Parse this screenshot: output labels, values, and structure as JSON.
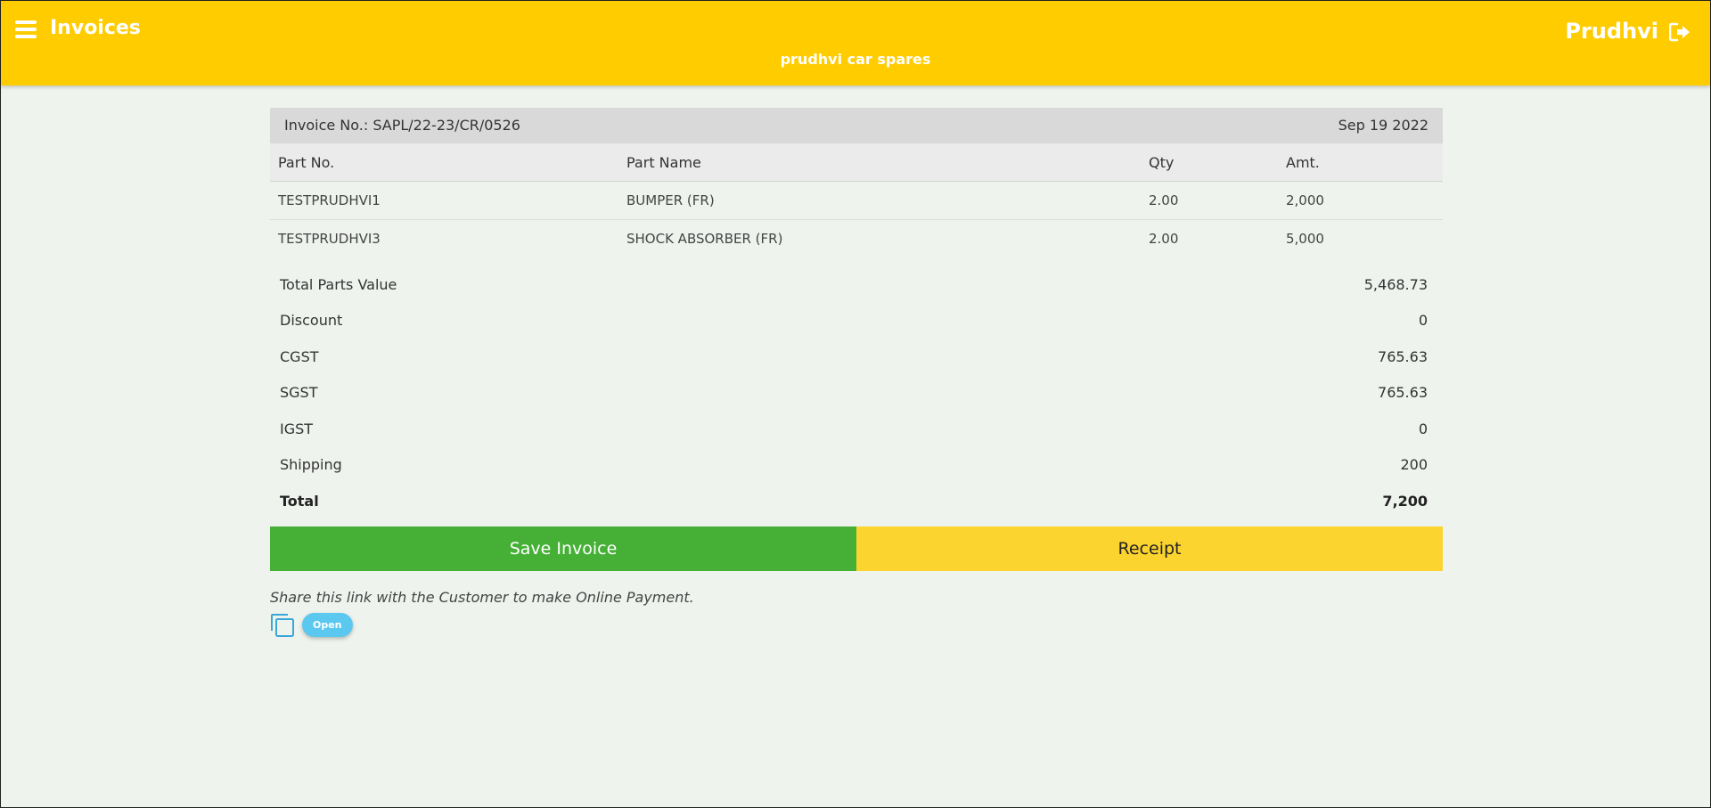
{
  "header": {
    "title": "Invoices",
    "subtitle": "prudhvi car spares",
    "user_name": "Prudhvi",
    "menu_icon": "hamburger-menu-icon",
    "logout_icon": "logout-icon",
    "background_color": "#ffcc00"
  },
  "invoice": {
    "number_label": "Invoice No.: SAPL/22-23/CR/0526",
    "date": "Sep 19 2022"
  },
  "parts_table": {
    "columns": [
      "Part No.",
      "Part Name",
      "Qty",
      "Amt."
    ],
    "rows": [
      {
        "part_no": "TESTPRUDHVI1",
        "part_name": "BUMPER (FR)",
        "qty": "2.00",
        "amt": "2,000"
      },
      {
        "part_no": "TESTPRUDHVI3",
        "part_name": "SHOCK ABSORBER (FR)",
        "qty": "2.00",
        "amt": "5,000"
      }
    ]
  },
  "summary": {
    "rows": [
      {
        "label": "Total Parts Value",
        "value": "5,468.73"
      },
      {
        "label": "Discount",
        "value": "0"
      },
      {
        "label": "CGST",
        "value": "765.63"
      },
      {
        "label": "SGST",
        "value": "765.63"
      },
      {
        "label": "IGST",
        "value": "0"
      },
      {
        "label": "Shipping",
        "value": "200"
      },
      {
        "label": "Total",
        "value": "7,200"
      }
    ]
  },
  "actions": {
    "save_label": "Save Invoice",
    "receipt_label": "Receipt",
    "save_color": "#46b036",
    "receipt_color": "#fbd430"
  },
  "share": {
    "text": "Share this link with the Customer to make Online Payment.",
    "copy_icon": "copy-icon",
    "open_label": "Open",
    "open_color": "#5bc8f0"
  }
}
